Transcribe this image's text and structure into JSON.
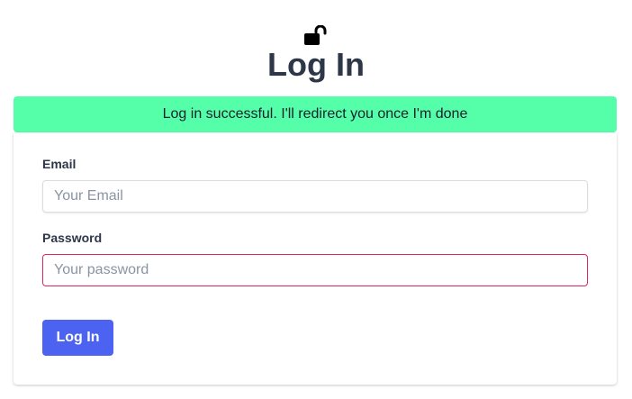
{
  "header": {
    "icon": "unlocked-lock-icon",
    "title": "Log In"
  },
  "alert": {
    "message": "Log in successful. I'll redirect you once I'm done",
    "color": "#55ffaa"
  },
  "form": {
    "email_label": "Email",
    "email_placeholder": "Your Email",
    "email_value": "",
    "password_label": "Password",
    "password_placeholder": "Your password",
    "password_value": "",
    "password_border_color": "#e0245e",
    "submit_label": "Log In",
    "submit_color": "#4c63f2"
  }
}
